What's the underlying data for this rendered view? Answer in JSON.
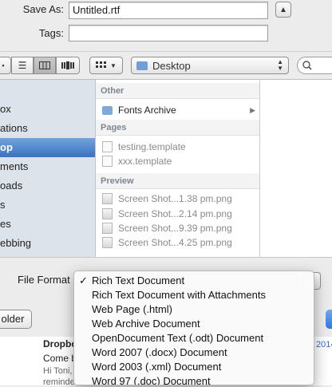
{
  "save_form": {
    "save_as_label": "Save As:",
    "save_as_value": "Untitled.rtf",
    "tags_label": "Tags:",
    "tags_value": ""
  },
  "toolbar": {
    "location": "Desktop"
  },
  "sidebar": {
    "items": [
      {
        "label": "ox"
      },
      {
        "label": "ations"
      },
      {
        "label": "op",
        "selected": true
      },
      {
        "label": "ments"
      },
      {
        "label": "oads"
      },
      {
        "label": "s"
      },
      {
        "label": "es"
      },
      {
        "label": "ebbing"
      }
    ]
  },
  "browser": {
    "sections": [
      {
        "title": "Other",
        "items": [
          {
            "name": "Fonts Archive",
            "icon": "folder-icon",
            "has_arrow": true
          }
        ]
      },
      {
        "title": "Pages",
        "items": [
          {
            "name": "testing.template",
            "icon": "document-icon"
          },
          {
            "name": "xxx.template",
            "icon": "document-icon"
          }
        ]
      },
      {
        "title": "Preview",
        "items": [
          {
            "name": "Screen Shot...1.38 pm.png",
            "icon": "image-icon"
          },
          {
            "name": "Screen Shot...2.14 pm.png",
            "icon": "image-icon"
          },
          {
            "name": "Screen Shot...9.39 pm.png",
            "icon": "image-icon"
          },
          {
            "name": "Screen Shot...4.25 pm.png",
            "icon": "image-icon"
          }
        ]
      }
    ]
  },
  "file_format": {
    "label": "File Format",
    "options": [
      {
        "label": "Rich Text Document",
        "checked": true
      },
      {
        "label": "Rich Text Document with Attachments"
      },
      {
        "label": "Web Page (.html)"
      },
      {
        "label": "Web Archive Document"
      },
      {
        "label": "OpenDocument Text (.odt) Document"
      },
      {
        "label": "Word 2007 (.docx) Document"
      },
      {
        "label": "Word 2003 (.xml) Document"
      },
      {
        "label": "Word 97 (.doc) Document"
      }
    ],
    "check_mark": "✓"
  },
  "buttons": {
    "new_folder_partial": "older"
  },
  "background_mail": {
    "sender": "Dropbo",
    "line1": "Come b",
    "line2": "Hi Toni,",
    "line3": "reminde",
    "year": "2014"
  }
}
